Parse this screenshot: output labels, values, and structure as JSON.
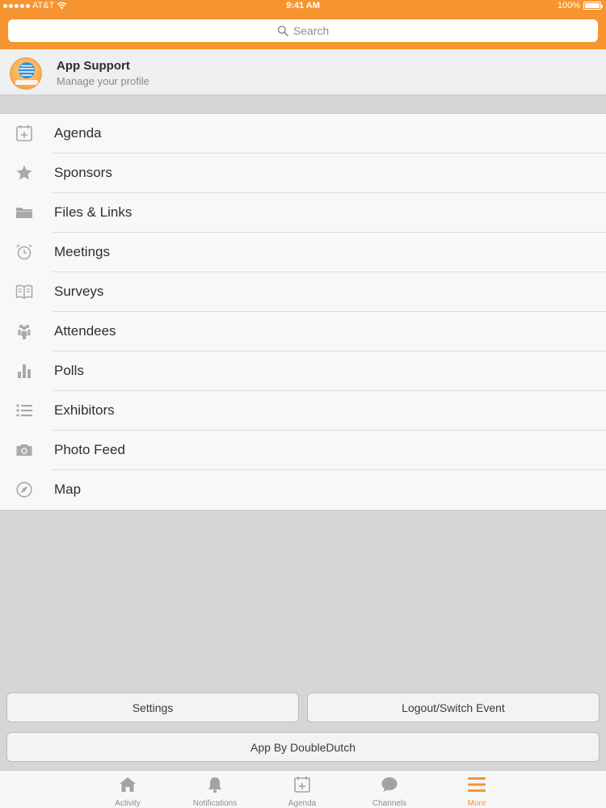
{
  "status": {
    "carrier": "AT&T",
    "time": "9:41 AM",
    "battery": "100%"
  },
  "search": {
    "placeholder": "Search"
  },
  "profile": {
    "name": "App Support",
    "subtitle": "Manage your profile"
  },
  "menu": [
    {
      "label": "Agenda",
      "icon": "calendar-add-icon"
    },
    {
      "label": "Sponsors",
      "icon": "star-icon"
    },
    {
      "label": "Files & Links",
      "icon": "folder-icon"
    },
    {
      "label": "Meetings",
      "icon": "alarm-clock-icon"
    },
    {
      "label": "Surveys",
      "icon": "open-book-icon"
    },
    {
      "label": "Attendees",
      "icon": "people-icon"
    },
    {
      "label": "Polls",
      "icon": "bar-chart-icon"
    },
    {
      "label": "Exhibitors",
      "icon": "list-icon"
    },
    {
      "label": "Photo Feed",
      "icon": "camera-icon"
    },
    {
      "label": "Map",
      "icon": "compass-icon"
    }
  ],
  "buttons": {
    "settings": "Settings",
    "logout": "Logout/Switch Event",
    "app_by": "App By DoubleDutch"
  },
  "tabs": [
    {
      "label": "Activity",
      "icon": "home-icon"
    },
    {
      "label": "Notifications",
      "icon": "bell-icon"
    },
    {
      "label": "Agenda",
      "icon": "calendar-add-icon"
    },
    {
      "label": "Channels",
      "icon": "chat-bubble-icon"
    },
    {
      "label": "More",
      "icon": "hamburger-menu-icon",
      "active": true
    }
  ],
  "colors": {
    "accent": "#f6952f",
    "icon_gray": "#a9a9ad",
    "tab_gray": "#a3a3a7"
  }
}
